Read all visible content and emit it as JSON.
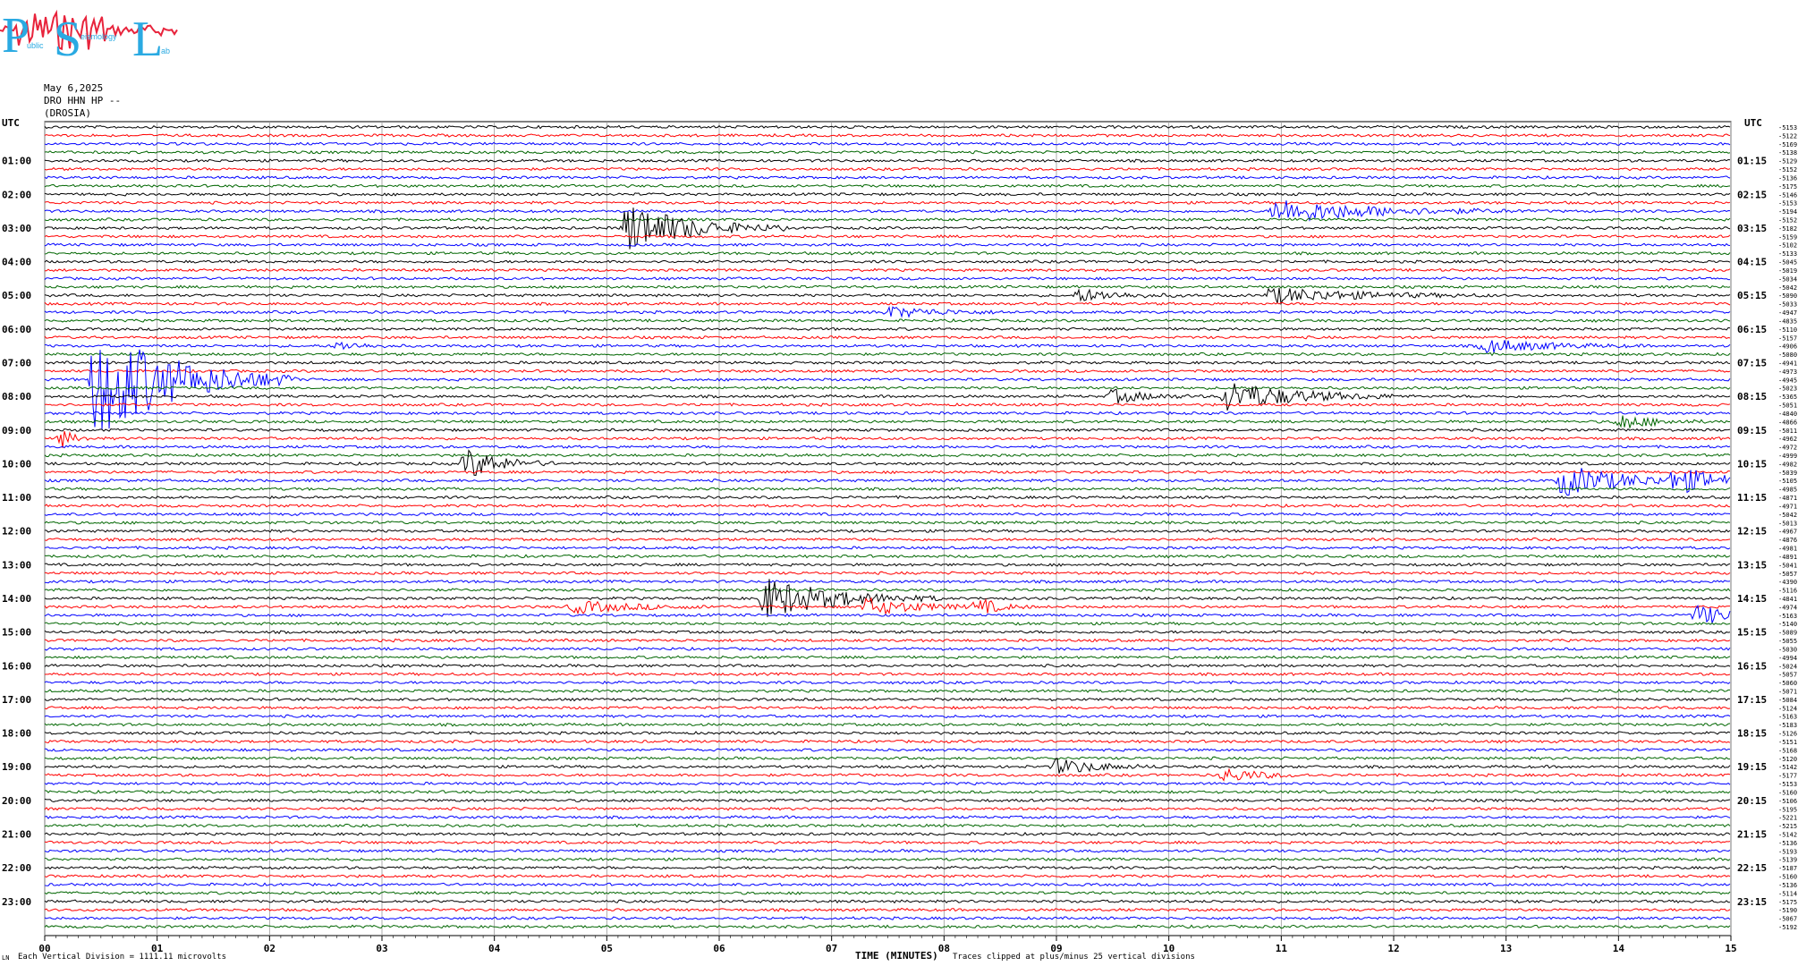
{
  "header": {
    "date": "May 6,2025",
    "station": "DRO HHN HP --",
    "location": "(DROSIA)",
    "logo": {
      "big_letters": [
        "P",
        "S",
        "L"
      ],
      "small_text": [
        "ublic",
        "eismology",
        "ab"
      ],
      "letter_color": "#2aaae2",
      "wave_color": "#e8243c"
    }
  },
  "footer": {
    "scale_note": "Each Vertical Division = 1111.11 microvolts",
    "clip_note": "Traces clipped at plus/minus 25 vertical divisions"
  },
  "chart_data": {
    "type": "line",
    "title": "",
    "xlabel": "TIME (MINUTES)",
    "ylabel": "",
    "xlim": [
      0,
      15
    ],
    "x_ticks": [
      "00",
      "01",
      "02",
      "03",
      "04",
      "05",
      "06",
      "07",
      "08",
      "09",
      "10",
      "11",
      "12",
      "13",
      "14",
      "15"
    ],
    "left_axis_title": "UTC",
    "right_axis_title": "UTC",
    "left_hour_labels": [
      "01:00",
      "02:00",
      "03:00",
      "04:00",
      "05:00",
      "06:00",
      "07:00",
      "08:00",
      "09:00",
      "10:00",
      "11:00",
      "12:00",
      "13:00",
      "14:00",
      "15:00",
      "16:00",
      "17:00",
      "18:00",
      "19:00",
      "20:00",
      "21:00",
      "22:00",
      "23:00"
    ],
    "right_hour_labels": [
      "01:15",
      "02:15",
      "03:15",
      "04:15",
      "05:15",
      "06:15",
      "07:15",
      "08:15",
      "09:15",
      "10:15",
      "11:15",
      "12:15",
      "13:15",
      "14:15",
      "15:15",
      "16:15",
      "17:15",
      "18:15",
      "19:15",
      "20:15",
      "21:15",
      "22:15",
      "23:15"
    ],
    "trace_colors": [
      "#000000",
      "#ff0000",
      "#0000ff",
      "#006600"
    ],
    "trace_count": 96,
    "minutes_per_trace": 15,
    "grid": true,
    "trace_offsets": [
      "-5153",
      "-5122",
      "-5169",
      "-5138",
      "-5129",
      "-5152",
      "-5136",
      "-5175",
      "-5146",
      "-5153",
      "-5194",
      "-5152",
      "-5182",
      "-5159",
      "-5102",
      "-5133",
      "-5045",
      "-5019",
      "-5034",
      "-5042",
      "-5090",
      "-5033",
      "-4947",
      "-4835",
      "-5110",
      "-5157",
      "-4906",
      "-5080",
      "-4941",
      "-4973",
      "-4945",
      "-5023",
      "-5365",
      "-5051",
      "-4840",
      "-4866",
      "-5011",
      "-4962",
      "-4972",
      "-4999",
      "-4982",
      "-5039",
      "-5105",
      "-4985",
      "-4871",
      "-4971",
      "-5042",
      "-5013",
      "-4967",
      "-4876",
      "-4981",
      "-4891",
      "-5041",
      "-5057",
      "-4390",
      "-5116",
      "-4841",
      "-4974",
      "-5163",
      "-5140",
      "-5089",
      "-5055",
      "-5030",
      "-4994",
      "-5024",
      "-5057",
      "-5060",
      "-5071",
      "-5084",
      "-5124",
      "-5163",
      "-5183",
      "-5126",
      "-5151",
      "-5168",
      "-5120",
      "-5142",
      "-5177",
      "-5153",
      "-5160",
      "-5106",
      "-5195",
      "-5221",
      "-5215",
      "-5142",
      "-5136",
      "-5193",
      "-5139",
      "-5187",
      "-5160",
      "-5136",
      "-5114",
      "-5175",
      "-5190",
      "-5067",
      "-5192"
    ],
    "events": [
      {
        "trace": 12,
        "minute": 5.18,
        "amplitude": 30,
        "duration": 1.4
      },
      {
        "trace": 10,
        "minute": 10.95,
        "amplitude": 14,
        "duration": 2.2
      },
      {
        "trace": 20,
        "minute": 10.9,
        "amplitude": 9,
        "duration": 2.0
      },
      {
        "trace": 20,
        "minute": 9.2,
        "amplitude": 7,
        "duration": 1.0
      },
      {
        "trace": 22,
        "minute": 7.5,
        "amplitude": 6,
        "duration": 1.2
      },
      {
        "trace": 26,
        "minute": 12.8,
        "amplitude": 8,
        "duration": 1.4
      },
      {
        "trace": 26,
        "minute": 2.6,
        "amplitude": 5,
        "duration": 0.6
      },
      {
        "trace": 30,
        "minute": 0.45,
        "amplitude": 70,
        "duration": 1.8
      },
      {
        "trace": 32,
        "minute": 10.5,
        "amplitude": 18,
        "duration": 1.6
      },
      {
        "trace": 32,
        "minute": 9.5,
        "amplitude": 8,
        "duration": 0.8
      },
      {
        "trace": 35,
        "minute": 14.0,
        "amplitude": 9,
        "duration": 0.8
      },
      {
        "trace": 37,
        "minute": 0.15,
        "amplitude": 10,
        "duration": 0.3
      },
      {
        "trace": 40,
        "minute": 3.75,
        "amplitude": 18,
        "duration": 0.8
      },
      {
        "trace": 42,
        "minute": 13.5,
        "amplitude": 18,
        "duration": 1.5
      },
      {
        "trace": 42,
        "minute": 14.5,
        "amplitude": 14,
        "duration": 1.0
      },
      {
        "trace": 56,
        "minute": 6.4,
        "amplitude": 24,
        "duration": 1.6
      },
      {
        "trace": 57,
        "minute": 7.3,
        "amplitude": 10,
        "duration": 1.2
      },
      {
        "trace": 57,
        "minute": 4.7,
        "amplitude": 7,
        "duration": 1.4
      },
      {
        "trace": 57,
        "minute": 8.3,
        "amplitude": 9,
        "duration": 0.5
      },
      {
        "trace": 58,
        "minute": 14.7,
        "amplitude": 12,
        "duration": 0.8
      },
      {
        "trace": 76,
        "minute": 9.0,
        "amplitude": 9,
        "duration": 1.0
      },
      {
        "trace": 77,
        "minute": 10.5,
        "amplitude": 8,
        "duration": 0.8
      }
    ]
  }
}
